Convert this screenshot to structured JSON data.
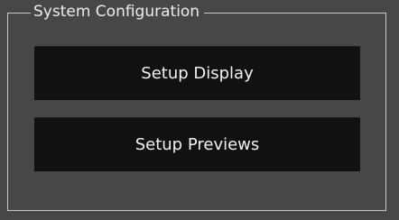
{
  "group": {
    "title": "System Configuration"
  },
  "buttons": {
    "setup_display": "Setup Display",
    "setup_previews": "Setup Previews"
  },
  "colors": {
    "background": "#474747",
    "button_bg": "#111111",
    "border": "#c9c9c9",
    "text": "#f1f1f1"
  }
}
